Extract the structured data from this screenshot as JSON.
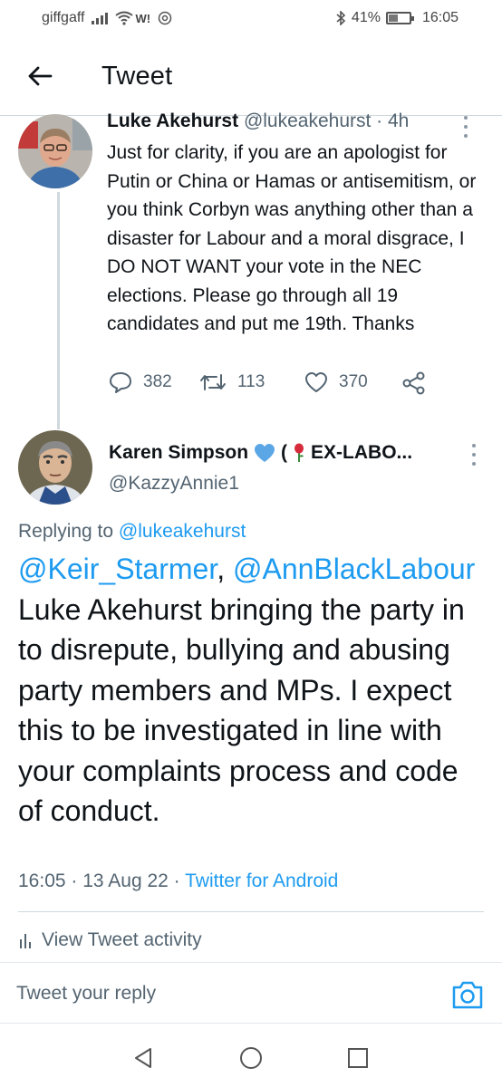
{
  "status_bar": {
    "carrier": "giffgaff",
    "wifi_text": "W!",
    "battery_percent": "41%",
    "battery_level": 0.41,
    "time": "16:05"
  },
  "header": {
    "title": "Tweet"
  },
  "tweet1": {
    "name": "Luke Akehurst",
    "handle": "@lukeakehurst",
    "time_ago": "4h",
    "meta_separator": " · ",
    "text": "Just for clarity, if you are an apologist for Putin or China or Hamas or antisemitism, or you think Corbyn was anything other than a disaster for Labour and a moral disgrace, I DO NOT WANT your vote in the NEC elections. Please go through all 19 candidates and put me 19th. Thanks",
    "replies": "382",
    "retweets": "113",
    "likes": "370"
  },
  "tweet2": {
    "name_main": "Karen Simpson",
    "name_suffix": "(",
    "name_tail": "EX-LABO...",
    "handle": "@KazzyAnnie1",
    "replying_prefix": "Replying to",
    "replying_handle": "@lukeakehurst",
    "mention1": "@Keir_Starmer",
    "mention_sep": ",",
    "mention2": "@AnnBlackLabour",
    "body": " Luke Akehurst bringing the party in to disrepute, bullying and abusing party members and MPs. I expect this to be investigated in line with your complaints process and code of conduct.",
    "time": "16:05",
    "date": "13 Aug 22",
    "sep": " · ",
    "source": "Twitter for Android"
  },
  "activity": {
    "label": "View Tweet activity"
  },
  "reply": {
    "placeholder": "Tweet your reply"
  },
  "colors": {
    "accent": "#1d9bf0",
    "text": "#0f1419",
    "secondary": "#536471",
    "border": "#cfd9de"
  }
}
